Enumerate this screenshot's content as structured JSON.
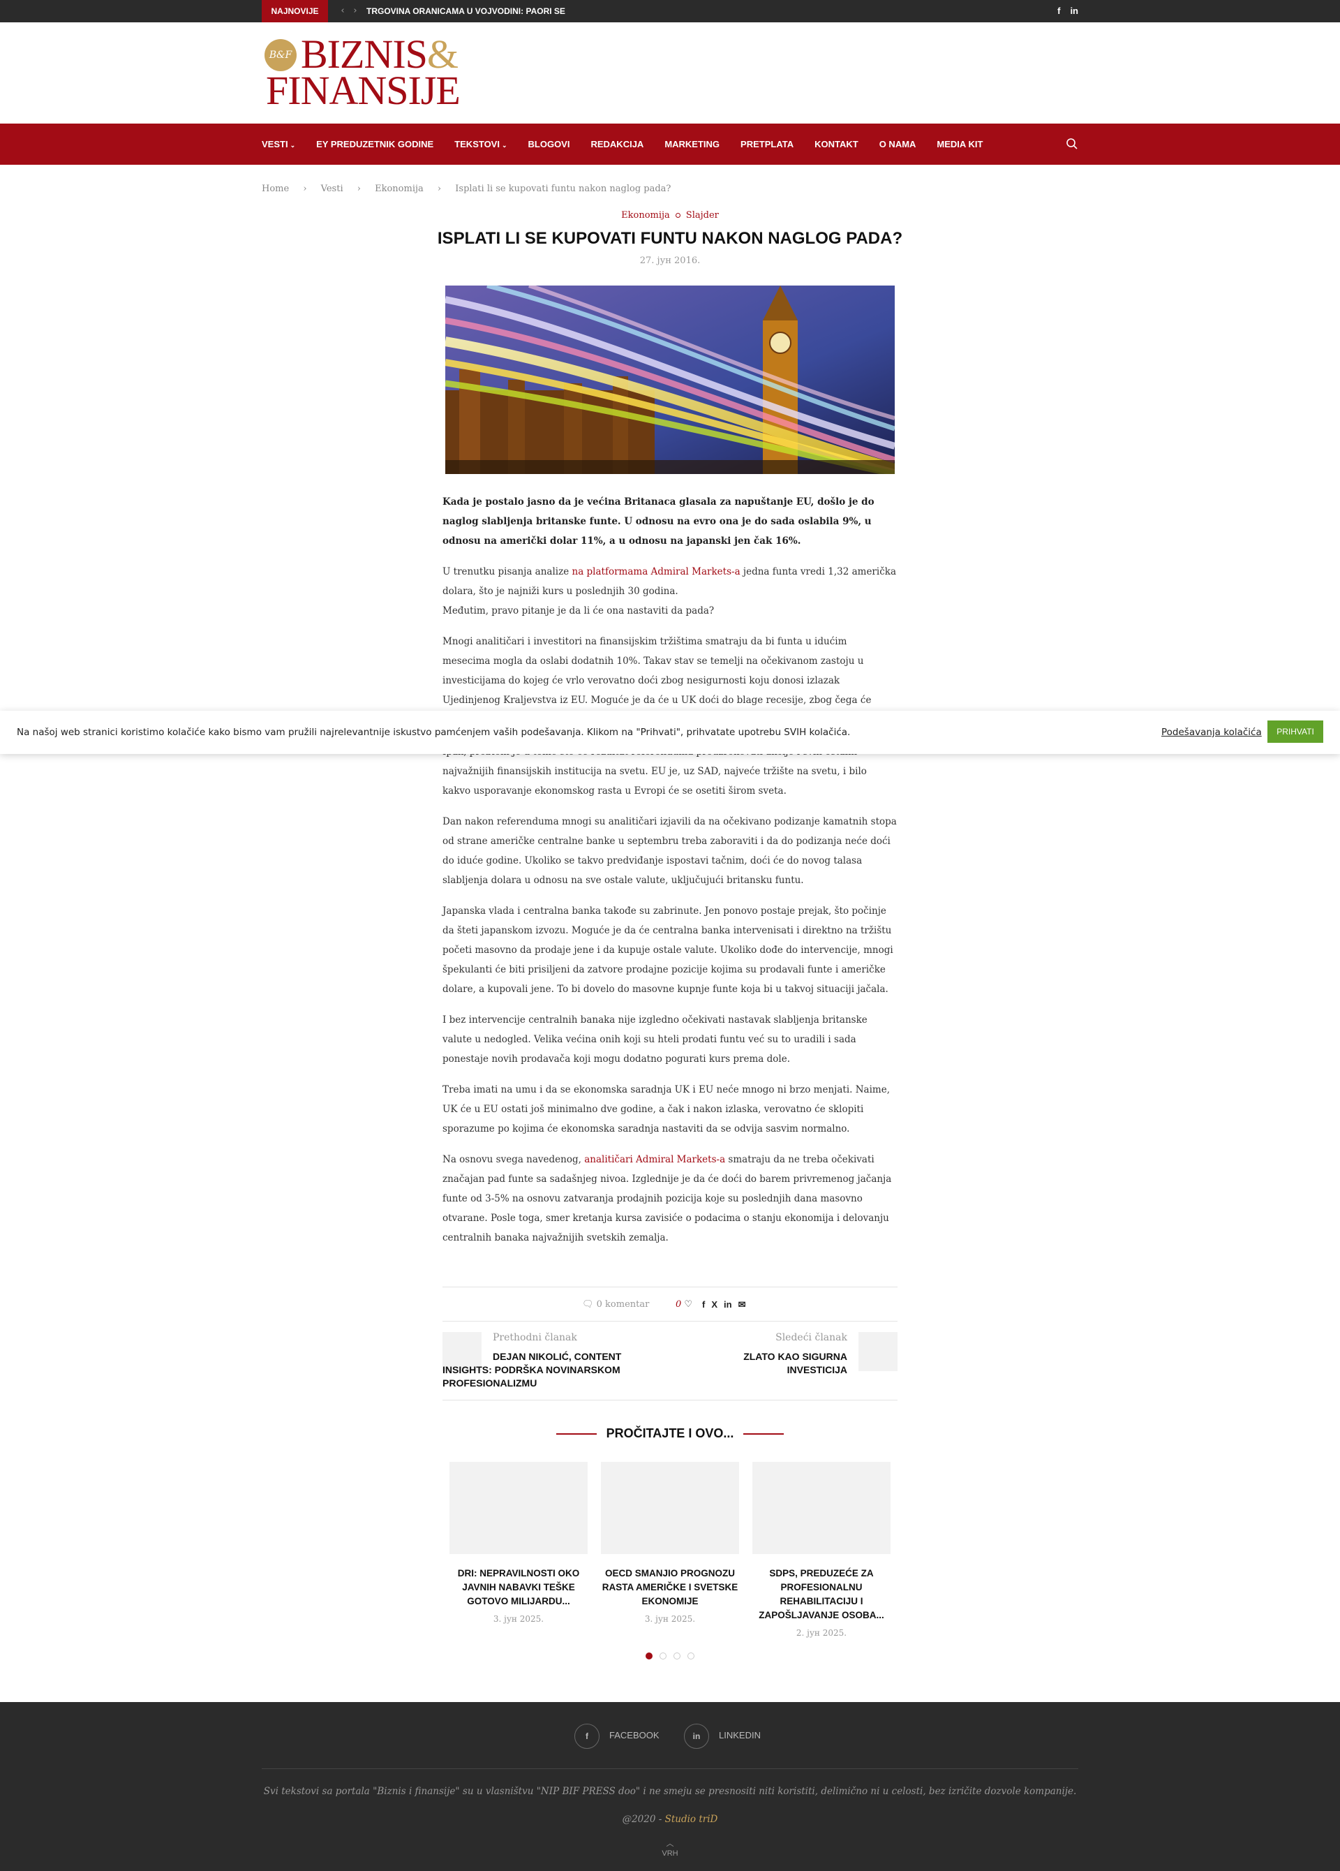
{
  "topbar": {
    "newest_label": "NAJNOVIJE",
    "ticker": "TRGOVINA ORANICAMA U VOJVODINI: PAORI SE",
    "social": [
      "f",
      "in"
    ]
  },
  "logo": {
    "seal": "B&F",
    "line1": "BIZNIS",
    "amp": "&",
    "line2": "FINANSIJE"
  },
  "nav": {
    "items": [
      {
        "label": "VESTI",
        "dropdown": true
      },
      {
        "label": "EY PREDUZETNIK GODINE",
        "dropdown": false
      },
      {
        "label": "TEKSTOVI",
        "dropdown": true
      },
      {
        "label": "BLOGOVI",
        "dropdown": false
      },
      {
        "label": "REDAKCIJA",
        "dropdown": false
      },
      {
        "label": "MARKETING",
        "dropdown": false
      },
      {
        "label": "PRETPLATA",
        "dropdown": false
      },
      {
        "label": "KONTAKT",
        "dropdown": false
      },
      {
        "label": "O NAMA",
        "dropdown": false
      },
      {
        "label": "MEDIA KIT",
        "dropdown": false
      }
    ]
  },
  "breadcrumb": [
    "Home",
    "Vesti",
    "Ekonomija",
    "Isplati li se kupovati funtu nakon naglog pada?"
  ],
  "article": {
    "categories": [
      "Ekonomija",
      "Slajder"
    ],
    "title": "ISPLATI LI SE KUPOVATI FUNTU NAKON NAGLOG PADA?",
    "date": "27. јун 2016.",
    "lead": "Kada je postalo jasno da je većina Britanaca glasala za napuštanje EU, došlo je do naglog slabljenja britanske funte. U odnosu na evro ona je do sada oslabila 9%, u odnosu na američki dolar 11%, a u odnosu na japanski jen čak 16%.",
    "p1_before": "U trenutku pisanja analize ",
    "p1_link": "na platformama Admiral Markets-a",
    "p1_after": " jedna funta vredi 1,32 američka dolara, što je najniži kurs u poslednjih 30 godina.",
    "p1_line2": "Međutim, pravo pitanje je da li će ona nastaviti da pada?",
    "p2": "Mnogi analitičari i investitori na finansijskim tržištima smatraju da bi funta u idućim mesecima mogla da oslabi dodatnih 10%. Takav stav se temelji na očekivanom zastoju u investicijama do kojeg će vrlo verovatno doći zbog nesigurnosti koju donosi izlazak Ujedinjenog Kraljevstva iz EU. Moguće je da će u UK doći do blage recesije, zbog čega će britanska centralna banka morati dodatno da popusti monetarnu",
    "p3": "Ipak, problem je u tome što će rezultat referenduma prouzrokovati akcije i svih ostalih najvažnijih finansijskih institucija na svetu. EU je, uz SAD, najveće tržište na svetu, i bilo kakvo usporavanje ekonomskog rasta u Evropi će se osetiti širom sveta.",
    "p4": "Dan nakon referenduma mnogi su analitičari izjavili da na očekivano podizanje kamatnih stopa od strane američke centralne banke u septembru treba zaboraviti i da do podizanja neće doći do iduće godine. Ukoliko se takvo predviđanje ispostavi tačnim, doći će do novog talasa slabljenja dolara u odnosu na sve ostale valute, uključujući britansku funtu.",
    "p5": "Japanska vlada i centralna banka takođe su zabrinute. Jen ponovo postaje prejak, što počinje da šteti japanskom izvozu. Moguće je da će centralna banka intervenisati i direktno na tržištu početi masovno da prodaje jene i da kupuje ostale valute. Ukoliko dođe do intervencije, mnogi špekulanti će biti prisiljeni da zatvore prodajne pozicije kojima su prodavali funte i američke dolare, a kupovali jene. To bi dovelo do masovne kupnje funte koja bi u takvoj situaciji jačala.",
    "p6": "I bez intervencije centralnih banaka nije izgledno očekivati nastavak slabljenja britanske valute u nedogled. Velika većina onih koji su hteli prodati funtu već su to uradili i sada ponestaje novih prodavača koji mogu dodatno pogurati kurs prema dole.",
    "p7": "Treba imati na umu i da se ekonomska saradnja UK i EU neće mnogo ni brzo menjati. Naime, UK će u EU ostati još minimalno dve godine, a čak i nakon izlaska, verovatno će sklopiti sporazume po kojima će ekonomska saradnja nastaviti da se odvija sasvim normalno.",
    "p8_before": "Na osnovu svega navedenog, ",
    "p8_link": "analitičari Admiral Markets-a",
    "p8_after": " smatraju da ne treba očekivati značajan pad funte sa sadašnjeg nivoa. Izglednije je da će doći do barem privremenog jačanja funte od 3-5% na osnovu zatvaranja prodajnih pozicija koje su poslednjih dana masovno otvarane. Posle toga, smer kretanja kursa zavisiće o podacima o stanju ekonomija i delovanju centralnih banaka najvažnijih svetskih zemalja."
  },
  "cookie": {
    "message": "Na našoj web stranici koristimo kolačiće kako bismo vam pružili najrelevantnije iskustvo pamćenjem vaših podešavanja. Klikom na \"Prihvati\", prihvatate upotrebu SVIH kolačića.",
    "settings": "Podešavanja kolačića",
    "accept": "PRIHVATI"
  },
  "share": {
    "comments": "0 komentar",
    "likes": "0",
    "icons": [
      "f",
      "X",
      "in",
      "✉"
    ]
  },
  "postnav": {
    "prev_label": "Prethodni članak",
    "prev_title": "DEJAN NIKOLIĆ, CONTENT INSIGHTS: PODRŠKA NOVINARSKOM PROFESIONALIZMU",
    "next_label": "Sledeći članak",
    "next_title": "ZLATO KAO SIGURNA INVESTICIJA"
  },
  "related": {
    "heading": "PROČITAJTE I OVO...",
    "items": [
      {
        "title": "DRI: NEPRAVILNOSTI OKO JAVNIH NABAVKI TEŠKE GOTOVO MILIJARDU...",
        "date": "3. јун 2025."
      },
      {
        "title": "OECD SMANJIO PROGNOZU RASTA AMERIČKE I SVETSKE EKONOMIJE",
        "date": "3. јун 2025."
      },
      {
        "title": "SDPS, PREDUZEĆE ZA PROFESIONALNU REHABILITACIJU I ZAPOŠLJAVANJE OSOBA...",
        "date": "2. јун 2025."
      }
    ],
    "active_dot": 0,
    "dot_count": 4
  },
  "footer": {
    "facebook": "FACEBOOK",
    "linkedin": "LINKEDIN",
    "copyright": "Svi tekstovi sa portala \"Biznis i finansije\" su u vlasništvu \"NIP BIF PRESS doo\" i ne smeju se presnositi niti koristiti, delimično ni u celosti, bez izričite dozvole kompanije.",
    "credit_prefix": "@2020 - ",
    "credit_studio": "Studio triD",
    "top": "VRH"
  },
  "colors": {
    "brand_red": "#a20c15",
    "gold": "#c9a35a",
    "dark": "#2b2b2b",
    "cookie_green": "#61a229"
  }
}
